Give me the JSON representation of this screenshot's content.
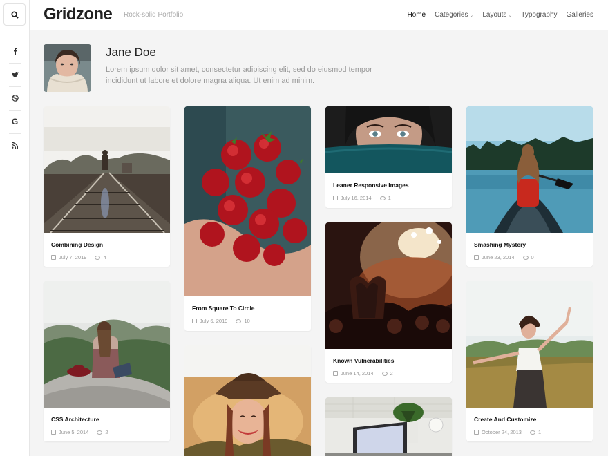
{
  "brand": {
    "logo": "Gridzone",
    "tagline": "Rock-solid Portfolio"
  },
  "nav": {
    "items": [
      {
        "label": "Home",
        "active": true,
        "dropdown": false
      },
      {
        "label": "Categories",
        "active": false,
        "dropdown": true
      },
      {
        "label": "Layouts",
        "active": false,
        "dropdown": true
      },
      {
        "label": "Typography",
        "active": false,
        "dropdown": false
      },
      {
        "label": "Galleries",
        "active": false,
        "dropdown": false
      }
    ]
  },
  "sidebar": {
    "search_icon": "search-icon",
    "social": [
      {
        "icon": "facebook-icon",
        "glyph": "f"
      },
      {
        "icon": "twitter-icon",
        "glyph": "🐦"
      },
      {
        "icon": "dribbble-icon",
        "glyph": "⊕"
      },
      {
        "icon": "google-icon",
        "glyph": "G"
      },
      {
        "icon": "rss-icon",
        "glyph": ")"
      }
    ]
  },
  "author": {
    "name": "Jane Doe",
    "bio": "Lorem ipsum dolor sit amet, consectetur adipiscing elit, sed do eiusmod tempor incididunt ut labore et dolore magna aliqua. Ut enim ad minim."
  },
  "posts": [
    {
      "title": "Combining Design",
      "date": "July 7, 2019",
      "comments": "4"
    },
    {
      "title": "From Square To Circle",
      "date": "July 6, 2019",
      "comments": "10"
    },
    {
      "title": "Leaner Responsive Images",
      "date": "July 16, 2014",
      "comments": "1"
    },
    {
      "title": "Smashing Mystery",
      "date": "June 23, 2014",
      "comments": "0"
    },
    {
      "title": "CSS Architecture",
      "date": "June 5, 2014",
      "comments": "2"
    },
    {
      "title": "Known Vulnerabilities",
      "date": "June 14, 2014",
      "comments": "2"
    },
    {
      "title": "Create And Customize",
      "date": "October 24, 2013",
      "comments": "1"
    }
  ]
}
